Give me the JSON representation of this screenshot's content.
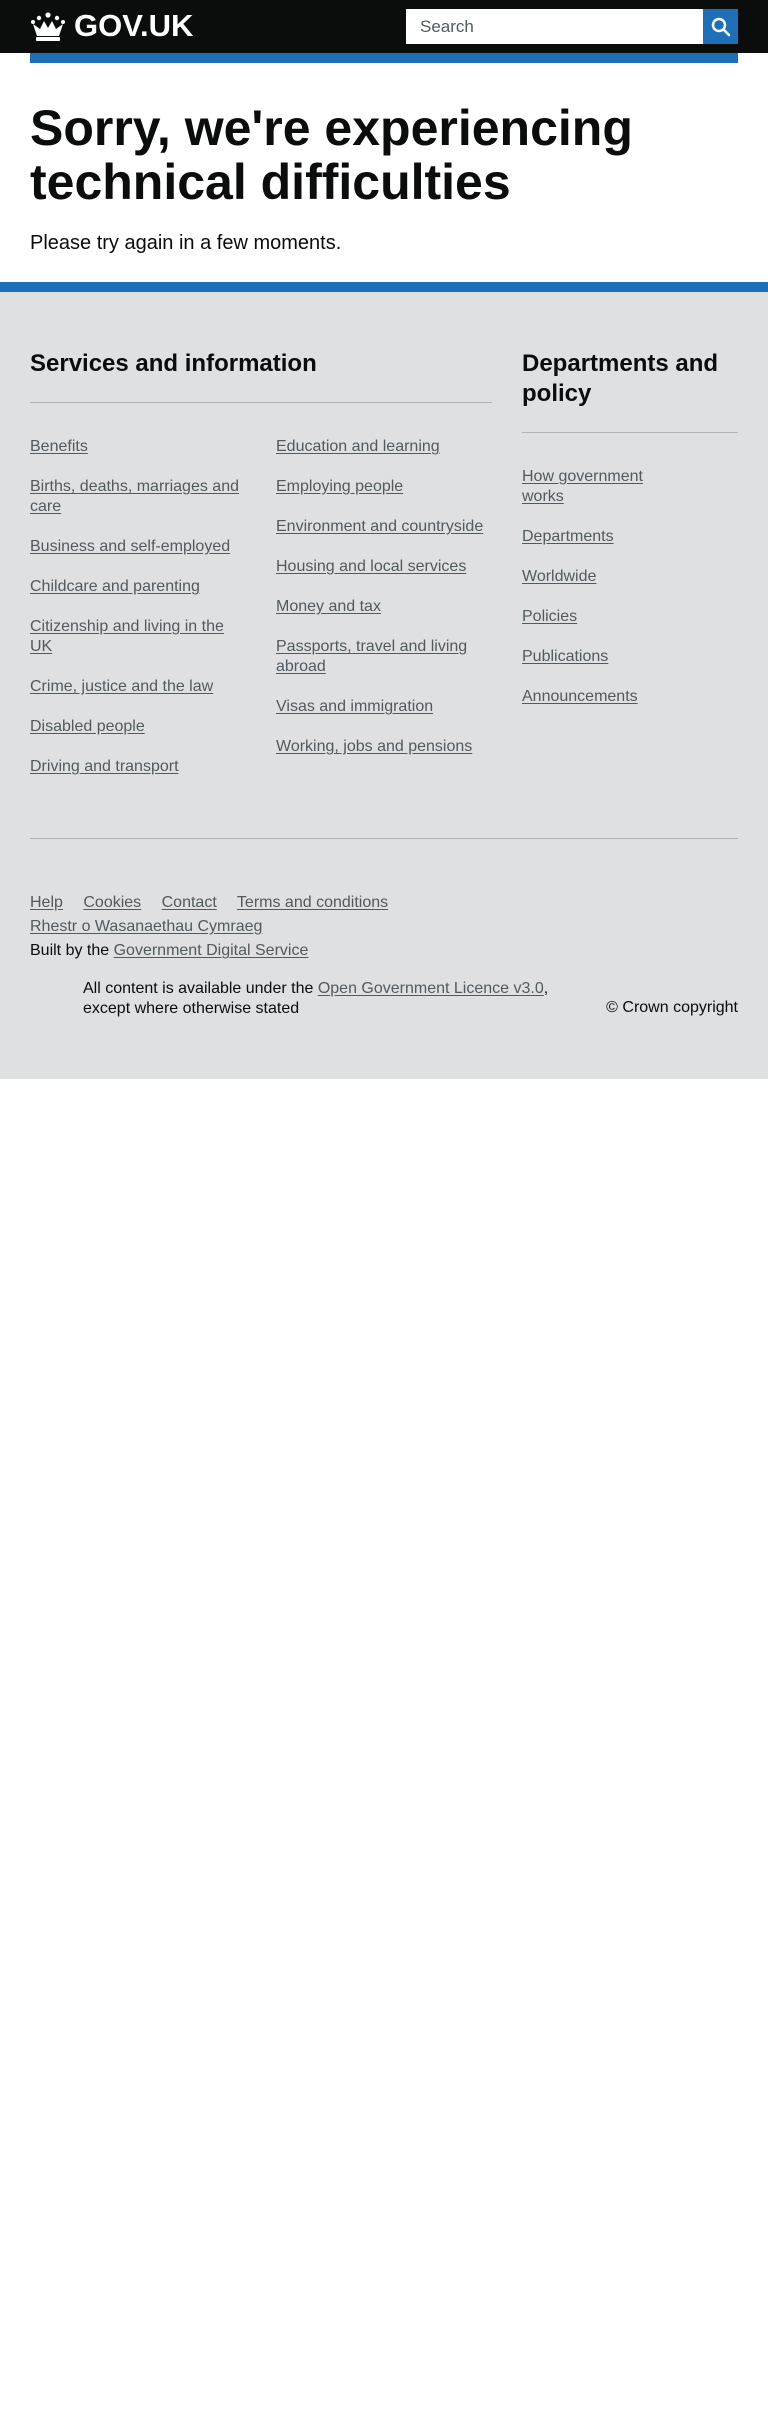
{
  "header": {
    "logo_text": "GOV.UK",
    "search_placeholder": "Search",
    "accent_color": "#1d70b8"
  },
  "main": {
    "title": "Sorry, we're experiencing technical difficulties",
    "message": "Please try again in a few moments."
  },
  "footer": {
    "services": {
      "heading": "Services and information",
      "col1": [
        "Benefits",
        "Births, deaths, marriages and care",
        "Business and self-employed",
        "Childcare and parenting",
        "Citizenship and living in the UK",
        "Crime, justice and the law",
        "Disabled people",
        "Driving and transport"
      ],
      "col2": [
        "Education and learning",
        "Employing people",
        "Environment and countryside",
        "Housing and local services",
        "Money and tax",
        "Passports, travel and living abroad",
        "Visas and immigration",
        "Working, jobs and pensions"
      ]
    },
    "departments": {
      "heading": "Departments and policy",
      "items": [
        "How government works",
        "Departments",
        "Worldwide",
        "Policies",
        "Publications",
        "Announcements"
      ]
    },
    "meta": {
      "help": "Help",
      "cookies": "Cookies",
      "contact": "Contact",
      "terms": "Terms and conditions",
      "welsh": "Rhestr o Wasanaethau Cymraeg",
      "built_by_prefix": "Built by the",
      "built_by_link": "Government Digital Service",
      "licence_prefix": "All content is available under the",
      "licence_link": "Open Government Licence v3.0",
      "licence_suffix": ", except where otherwise stated",
      "copyright": "© Crown copyright"
    },
    "background_color": "#dfe0e2"
  }
}
